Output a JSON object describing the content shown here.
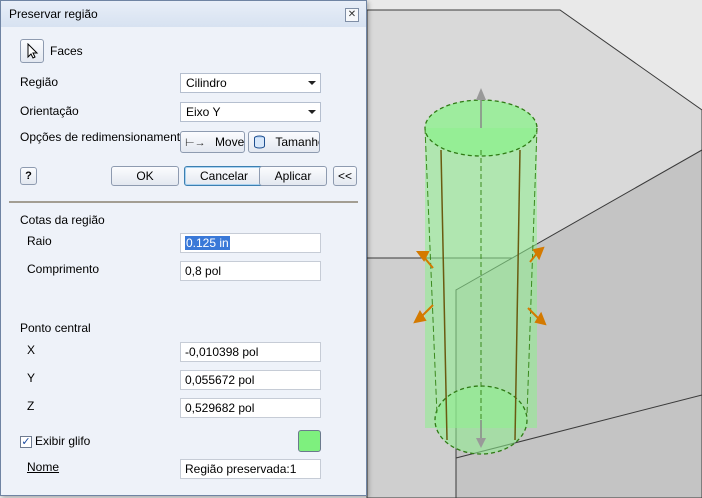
{
  "dialog": {
    "title": "Preservar região",
    "close_glyph": "✕",
    "faces_label": "Faces",
    "regiao": {
      "label": "Região",
      "value": "Cilindro"
    },
    "orientacao": {
      "label": "Orientação",
      "value": "Eixo Y"
    },
    "redim": {
      "label": "Opções de redimensionamento",
      "move_label": "Mover",
      "size_label": "Tamanho"
    },
    "help_glyph": "?",
    "ok_label": "OK",
    "cancel_label": "Cancelar",
    "apply_label": "Aplicar",
    "collapse_label": "<<",
    "cotas": {
      "heading": "Cotas da região",
      "raio_label": "Raio",
      "raio_value": "0.125 in",
      "comprimento_label": "Comprimento",
      "comprimento_value": "0,8 pol"
    },
    "ponto": {
      "heading": "Ponto central",
      "x_label": "X",
      "x_value": "-0,010398 pol",
      "y_label": "Y",
      "y_value": "0,055672 pol",
      "z_label": "Z",
      "z_value": "0,529682 pol"
    },
    "exibir_glifo": {
      "label": "Exibir glifo",
      "checked": true,
      "check_glyph": "✓",
      "color": "#7ef07e"
    },
    "nome": {
      "label": "Nome",
      "value": "Região preservada:1"
    }
  },
  "colors": {
    "viewport_bg": "#e9e9e9",
    "block_top": "#d9d9d9",
    "block_side": "#c4c4c4",
    "cylinder_fill": "#8ef08e",
    "cylinder_edge": "#3b8a1e",
    "handle_color": "#d47a00"
  }
}
